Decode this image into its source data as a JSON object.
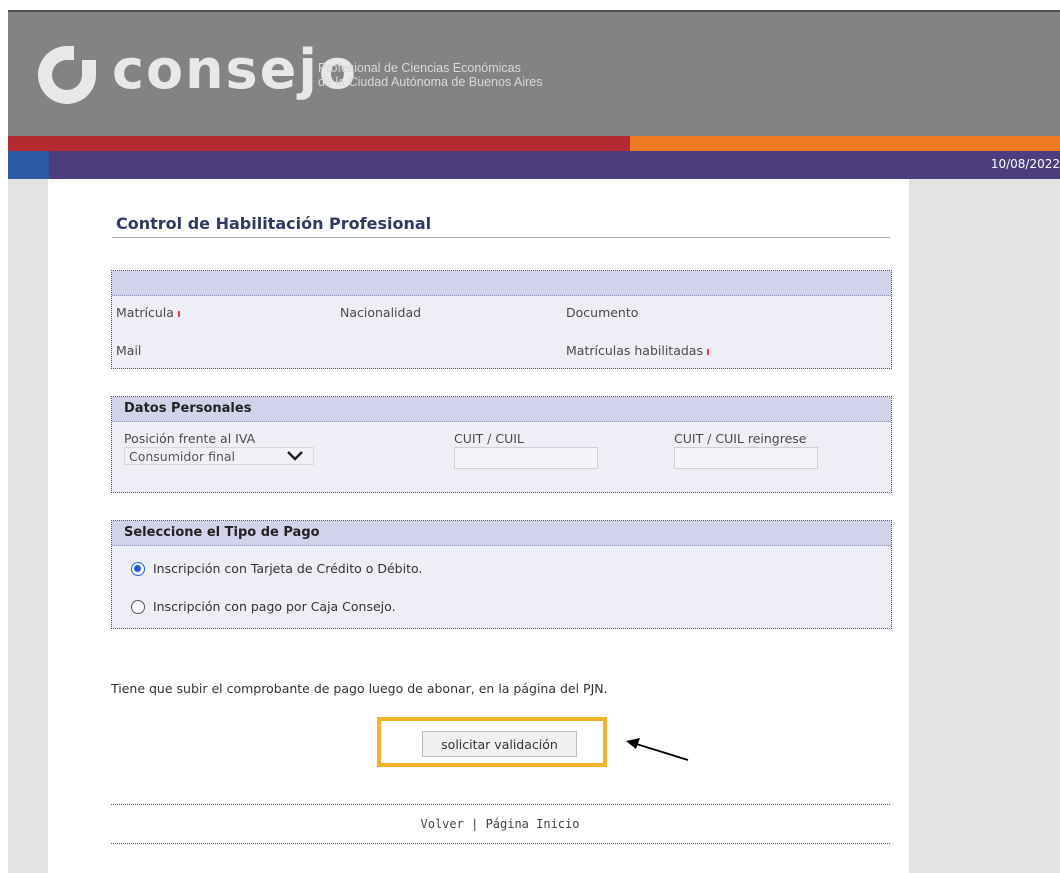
{
  "header": {
    "logo_text": "consejo",
    "org_line1": "Profesional de Ciencias Económicas",
    "org_line2": "de la Ciudad Autónoma de Buenos Aires",
    "date": "10/08/2022"
  },
  "colors": {
    "header_bg": "#838383",
    "stripe_red": "#b42a30",
    "stripe_orange": "#ed7a21",
    "nav_purple": "#4b3d7e",
    "panel_head": "#d2d2ea",
    "radio_accent": "#1a5fd6"
  },
  "page": {
    "title": "Control de Habilitación Profesional"
  },
  "info_panel": {
    "matricula_label": "Matrícula",
    "nacionalidad_label": "Nacionalidad",
    "documento_label": "Documento",
    "mail_label": "Mail",
    "matriculas_habilitadas_label": "Matrículas habilitadas"
  },
  "datos_personales": {
    "heading": "Datos Personales",
    "iva_label": "Posición frente al IVA",
    "iva_value": "Consumidor final",
    "cuit_label": "CUIT / CUIL",
    "cuit_value": "",
    "cuit_reingrese_label": "CUIT / CUIL reingrese",
    "cuit_reingrese_value": ""
  },
  "tipo_pago": {
    "heading": "Seleccione el Tipo de Pago",
    "options": [
      {
        "label": "Inscripción con Tarjeta de Crédito o Débito.",
        "selected": true
      },
      {
        "label": "Inscripción con pago por Caja Consejo.",
        "selected": false
      }
    ]
  },
  "notice": "Tiene que subir el comprobante de pago luego de abonar, en la página del PJN.",
  "submit_label": "solicitar validación",
  "footer": {
    "volver": "Volver",
    "separator": "|",
    "inicio": "Página Inicio"
  }
}
